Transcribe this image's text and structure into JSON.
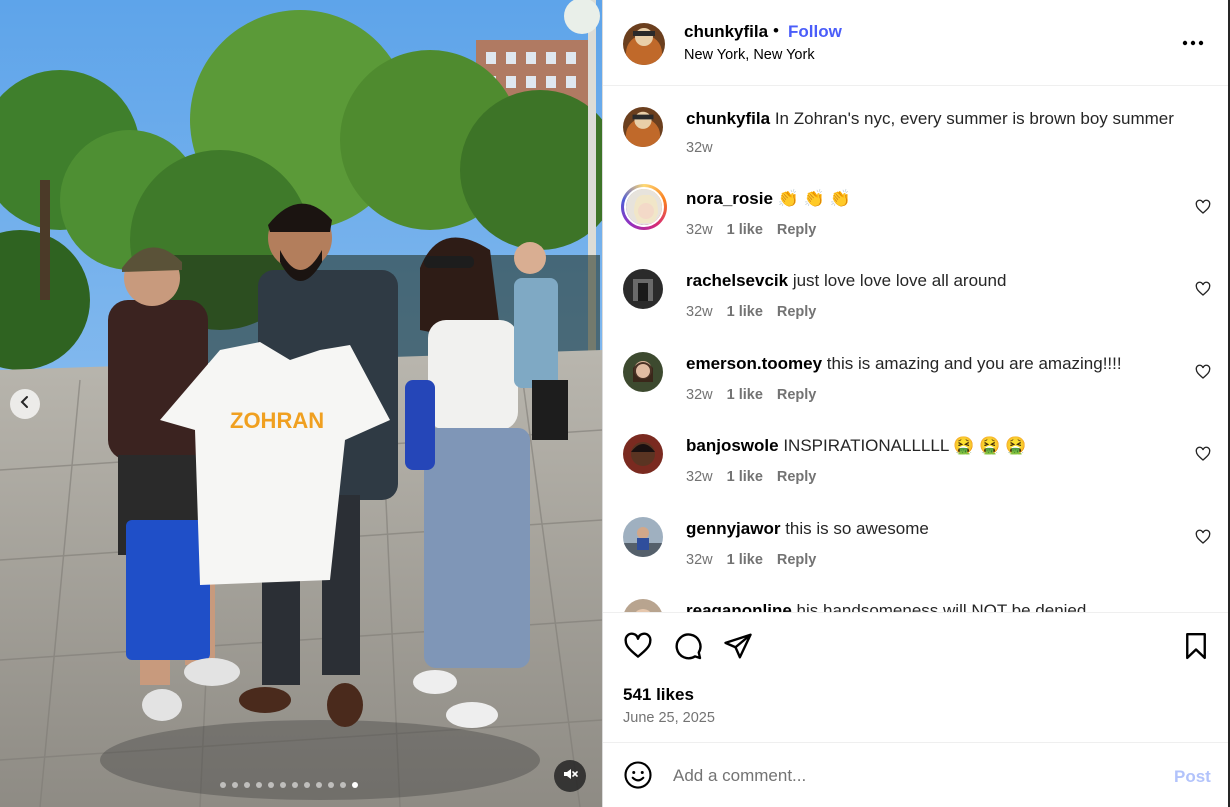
{
  "post": {
    "author": "chunkyfila",
    "separator": "•",
    "follow_label": "Follow",
    "location": "New York, New York",
    "more_icon": "more-horizontal-icon"
  },
  "caption": {
    "username": "chunkyfila",
    "text": "In Zohran's nyc, every summer is brown boy summer",
    "time": "32w"
  },
  "comments": [
    {
      "username": "nora_rosie",
      "text": "👏 👏 👏",
      "time": "32w",
      "likes": "1 like",
      "reply": "Reply"
    },
    {
      "username": "rachelsevcik",
      "text": "just love love love all around",
      "time": "32w",
      "likes": "1 like",
      "reply": "Reply"
    },
    {
      "username": "emerson.toomey",
      "text": "this is amazing and you are amazing!!!!",
      "time": "32w",
      "likes": "1 like",
      "reply": "Reply"
    },
    {
      "username": "banjoswole",
      "text": "INSPIRATIONALLLLL 🤮 🤮 🤮",
      "time": "32w",
      "likes": "1 like",
      "reply": "Reply"
    },
    {
      "username": "gennyjawor",
      "text": "this is so awesome",
      "time": "32w",
      "likes": "1 like",
      "reply": "Reply"
    },
    {
      "username": "reaganonline",
      "text": "his handsomeness will NOT be denied",
      "time": "",
      "likes": "",
      "reply": ""
    }
  ],
  "stats": {
    "likes": "541 likes",
    "date": "June 25, 2025"
  },
  "composer": {
    "placeholder": "Add a comment...",
    "post_label": "Post"
  },
  "carousel": {
    "total_slides": 12,
    "active_slide": 12
  },
  "colors": {
    "follow": "#4a5df9",
    "post_button_disabled": "#b2c3fb",
    "muted_text": "#737373",
    "story_ring": [
      "#feda75",
      "#fa7e1e",
      "#d62976",
      "#962fbf",
      "#4f5bd5"
    ]
  },
  "icons": {
    "like": "heart-icon",
    "comment": "comment-icon",
    "share": "share-icon",
    "save": "bookmark-icon",
    "emoji": "emoji-icon",
    "mute": "muted-speaker-icon",
    "prev": "chevron-left-icon"
  }
}
